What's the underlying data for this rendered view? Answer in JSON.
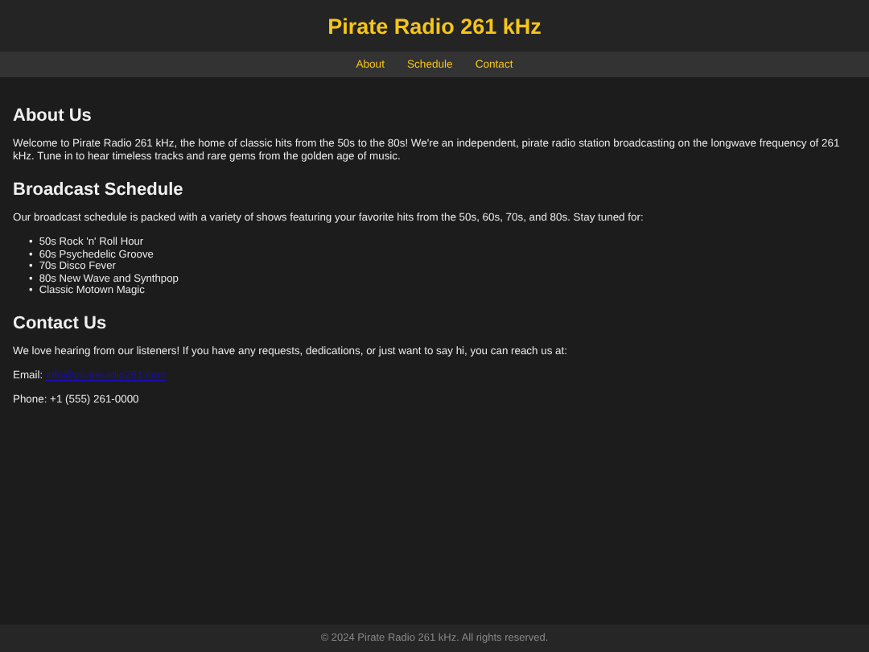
{
  "header": {
    "title": "Pirate Radio 261 kHz"
  },
  "nav": {
    "links": [
      "About",
      "Schedule",
      "Contact"
    ]
  },
  "about": {
    "heading": "About Us",
    "text": "Welcome to Pirate Radio 261 kHz, the home of classic hits from the 50s to the 80s! We're an independent, pirate radio station broadcasting on the longwave frequency of 261 kHz. Tune in to hear timeless tracks and rare gems from the golden age of music."
  },
  "schedule": {
    "heading": "Broadcast Schedule",
    "text": "Our broadcast schedule is packed with a variety of shows featuring your favorite hits from the 50s, 60s, 70s, and 80s. Stay tuned for:",
    "shows": [
      {
        "bullet": "•",
        "label": "50s Rock 'n' Roll Hour"
      },
      {
        "bullet": "•",
        "label": "60s Psychedelic Groove"
      },
      {
        "bullet": "•",
        "label": "70s Disco Fever"
      },
      {
        "bullet": "•",
        "label": "80s New Wave and Synthpop"
      },
      {
        "bullet": "•",
        "label": "Classic Motown Magic"
      }
    ]
  },
  "contact": {
    "heading": "Contact Us",
    "text": "We love hearing from our listeners! If you have any requests, dedications, or just want to say hi, you can reach us at:",
    "email_label": "Email:",
    "email": "info@pirateradio261.com",
    "phone": "Phone: +1 (555) 261-0000"
  },
  "footer": {
    "text": "© 2024 Pirate Radio 261 kHz. All rights reserved."
  }
}
